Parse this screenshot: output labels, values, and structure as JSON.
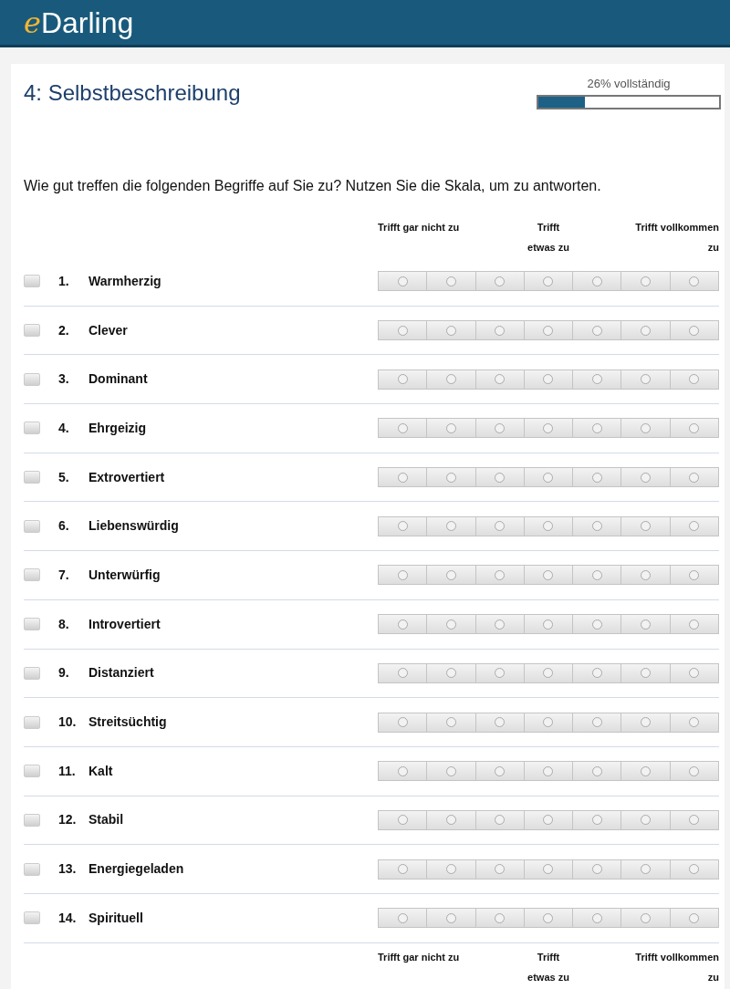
{
  "header": {
    "logo_prefix": "e",
    "logo_rest": "Darling"
  },
  "title": "4: Selbstbeschreibung",
  "progress": {
    "label": "26% vollständig",
    "level": 0.26
  },
  "question": "Wie gut treffen die folgenden Begriffe auf Sie zu? Nutzen Sie die Skala, um zu antworten.",
  "scale_top": [
    "Trifft gar nicht zu",
    "Trifft\netwas zu",
    "Trifft vollkommen\nzu"
  ],
  "items": [
    {
      "number": "1.",
      "label": "Warmherzig",
      "checked": false,
      "options": [
        false,
        false,
        false,
        false,
        false,
        false,
        false
      ]
    },
    {
      "number": "2.",
      "label": "Clever",
      "checked": false,
      "options": [
        false,
        false,
        false,
        false,
        false,
        false,
        false
      ]
    },
    {
      "number": "3.",
      "label": "Dominant",
      "checked": false,
      "options": [
        false,
        false,
        false,
        false,
        false,
        false,
        false
      ]
    },
    {
      "number": "4.",
      "label": "Ehrgeizig",
      "checked": false,
      "options": [
        false,
        false,
        false,
        false,
        false,
        false,
        false
      ]
    },
    {
      "number": "5.",
      "label": "Extrovertiert",
      "checked": false,
      "options": [
        false,
        false,
        false,
        false,
        false,
        false,
        false
      ]
    },
    {
      "number": "6.",
      "label": "Liebenswürdig",
      "checked": false,
      "options": [
        false,
        false,
        false,
        false,
        false,
        false,
        false
      ]
    },
    {
      "number": "7.",
      "label": "Unterwürfig",
      "checked": false,
      "options": [
        false,
        false,
        false,
        false,
        false,
        false,
        false
      ]
    },
    {
      "number": "8.",
      "label": "Introvertiert",
      "checked": false,
      "options": [
        false,
        false,
        false,
        false,
        false,
        false,
        false
      ]
    },
    {
      "number": "9.",
      "label": "Distanziert",
      "checked": false,
      "options": [
        false,
        false,
        false,
        false,
        false,
        false,
        false
      ]
    },
    {
      "number": "10.",
      "label": "Streitsüchtig",
      "checked": false,
      "options": [
        false,
        false,
        false,
        false,
        false,
        false,
        false
      ]
    },
    {
      "number": "11.",
      "label": "Kalt",
      "checked": false,
      "options": [
        false,
        false,
        false,
        false,
        false,
        false,
        false
      ]
    },
    {
      "number": "12.",
      "label": "Stabil",
      "checked": false,
      "options": [
        false,
        false,
        false,
        false,
        false,
        false,
        false
      ]
    },
    {
      "number": "13.",
      "label": "Energiegeladen",
      "checked": false,
      "options": [
        false,
        false,
        false,
        false,
        false,
        false,
        false
      ]
    },
    {
      "number": "14.",
      "label": "Spirituell",
      "checked": false,
      "options": [
        false,
        false,
        false,
        false,
        false,
        false,
        false
      ]
    }
  ],
  "scale_bottom": [
    "Trifft gar nicht zu",
    "Trifft\netwas zu",
    "Trifft vollkommen\nzu"
  ]
}
